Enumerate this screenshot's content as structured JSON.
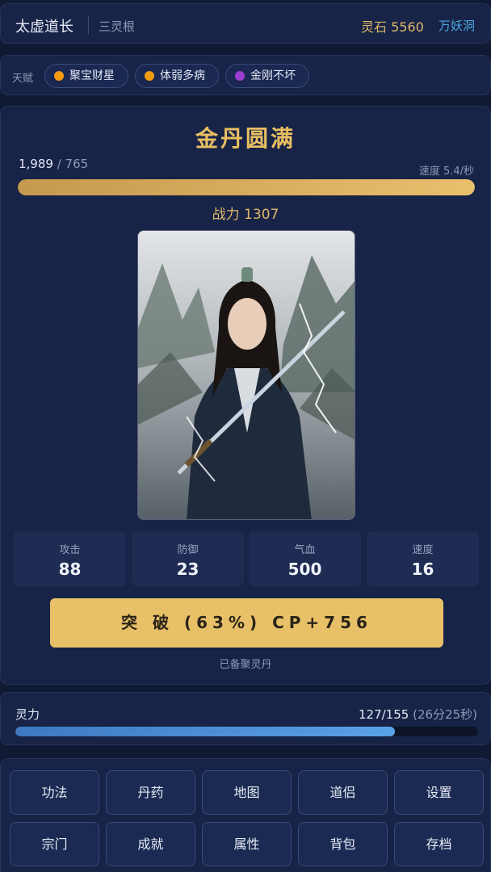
{
  "header": {
    "character_name": "太虚道长",
    "spirit_root": "三灵根",
    "spirit_stones": "灵石 5560",
    "location": "万妖洞"
  },
  "talents": {
    "label": "天赋",
    "items": [
      {
        "name": "聚宝财星",
        "color": "#f39c12"
      },
      {
        "name": "体弱多病",
        "color": "#f39c12"
      },
      {
        "name": "金刚不坏",
        "color": "#9b3dd1"
      }
    ]
  },
  "cultivation": {
    "realm": "金丹圆满",
    "exp_current": "1,989",
    "exp_max": "/ 765",
    "exp_progress": 1.0,
    "speed": "速度 5.4/秒",
    "combat_power": "战力 1307"
  },
  "stats": [
    {
      "label": "攻击",
      "value": "88"
    },
    {
      "label": "防御",
      "value": "23"
    },
    {
      "label": "气血",
      "value": "500"
    },
    {
      "label": "速度",
      "value": "16"
    }
  ],
  "breakthrough": {
    "label": "突 破 (63%) CP+756",
    "note": "已备聚灵丹"
  },
  "mana": {
    "label": "灵力",
    "value": "127/155",
    "regen_time": "(26分25秒)",
    "progress": 0.82
  },
  "menu": {
    "items": [
      "功法",
      "丹药",
      "地图",
      "道侣",
      "设置",
      "宗门",
      "成就",
      "属性",
      "背包",
      "存档"
    ]
  },
  "colors": {
    "accent_gold": "#e7c068",
    "mana_blue": "#4a8fd6",
    "background": "#111a33"
  }
}
